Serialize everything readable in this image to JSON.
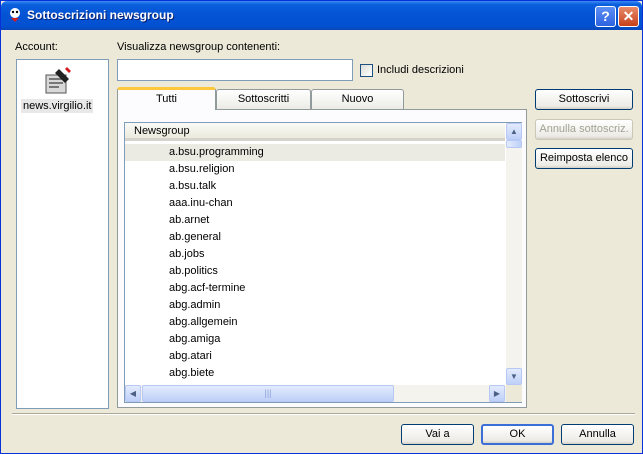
{
  "window": {
    "title": "Sottoscrizioni newsgroup",
    "help_label": "?",
    "close_label": "✕"
  },
  "accounts": {
    "label": "Account:",
    "items": [
      {
        "name": "news.virgilio.it",
        "icon": "news-server-icon"
      }
    ]
  },
  "filter": {
    "label": "Visualizza newsgroup contenenti:",
    "value": "",
    "placeholder": "",
    "include_descriptions_label": "Includi descrizioni",
    "include_descriptions_checked": false
  },
  "tabs": [
    {
      "label": "Tutti",
      "active": true
    },
    {
      "label": "Sottoscritti",
      "active": false
    },
    {
      "label": "Nuovo",
      "active": false
    }
  ],
  "newsgroup_list": {
    "column_header": "Newsgroup",
    "rows": [
      "a.bsu.programming",
      "a.bsu.religion",
      "a.bsu.talk",
      "aaa.inu-chan",
      "ab.arnet",
      "ab.general",
      "ab.jobs",
      "ab.politics",
      "abg.acf-termine",
      "abg.admin",
      "abg.allgemein",
      "abg.amiga",
      "abg.atari",
      "abg.biete"
    ],
    "selected_index": 0
  },
  "side_buttons": {
    "subscribe": "Sottoscrivi",
    "unsubscribe": "Annulla sottoscriz.",
    "reset": "Reimposta elenco"
  },
  "footer_buttons": {
    "goto": "Vai a",
    "ok": "OK",
    "cancel": "Annulla"
  },
  "colors": {
    "titlebar": "#0353d4",
    "window_bg": "#ece9d8",
    "tab_highlight": "#ffc83c",
    "border": "#7f9db9"
  }
}
